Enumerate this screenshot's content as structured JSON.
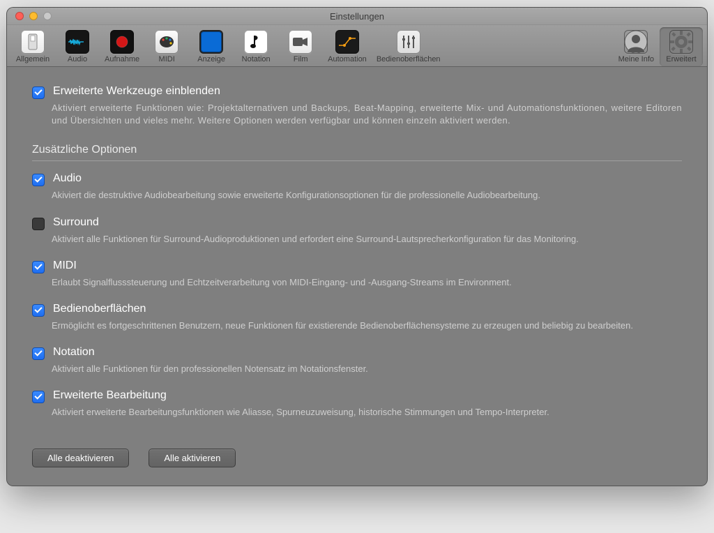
{
  "window": {
    "title": "Einstellungen"
  },
  "toolbar": {
    "items": [
      {
        "label": "Allgemein"
      },
      {
        "label": "Audio"
      },
      {
        "label": "Aufnahme"
      },
      {
        "label": "MIDI"
      },
      {
        "label": "Anzeige"
      },
      {
        "label": "Notation"
      },
      {
        "label": "Film"
      },
      {
        "label": "Automation"
      },
      {
        "label": "Bedienoberflächen"
      },
      {
        "label": "Meine Info"
      },
      {
        "label": "Erweitert"
      }
    ]
  },
  "main_option": {
    "title": "Erweiterte Werkzeuge einblenden",
    "desc": "Aktiviert erweiterte Funktionen wie: Projektalternativen und Backups, Beat-Mapping, erweiterte Mix- und Automationsfunktionen, weitere Editoren und Übersichten und vieles mehr. Weitere Optionen werden verfügbar und können einzeln aktiviert werden."
  },
  "section_title": "Zusätzliche Optionen",
  "options": [
    {
      "title": "Audio",
      "desc": "Akiviert die destruktive Audiobearbeitung sowie erweiterte Konfigurationsoptionen für die professionelle Audiobearbeitung.",
      "checked": true
    },
    {
      "title": "Surround",
      "desc": "Aktiviert alle Funktionen für Surround-Audioproduktionen und erfordert eine Surround-Lautsprecherkonfiguration für das Monitoring.",
      "checked": false
    },
    {
      "title": "MIDI",
      "desc": "Erlaubt Signalflusssteuerung und Echtzeitverarbeitung von MIDI-Eingang- und -Ausgang-Streams im Environment.",
      "checked": true
    },
    {
      "title": "Bedienoberflächen",
      "desc": "Ermöglicht es fortgeschrittenen Benutzern, neue Funktionen für existierende Bedienoberflächensysteme zu erzeugen und beliebig zu bearbeiten.",
      "checked": true
    },
    {
      "title": "Notation",
      "desc": "Aktiviert alle Funktionen für den professionellen Notensatz im Notationsfenster.",
      "checked": true
    },
    {
      "title": "Erweiterte Bearbeitung",
      "desc": "Aktiviert erweiterte Bearbeitungsfunktionen wie Aliasse, Spurneuzuweisung, historische Stimmungen und Tempo-Interpreter.",
      "checked": true
    }
  ],
  "buttons": {
    "disable_all": "Alle deaktivieren",
    "enable_all": "Alle aktivieren"
  }
}
